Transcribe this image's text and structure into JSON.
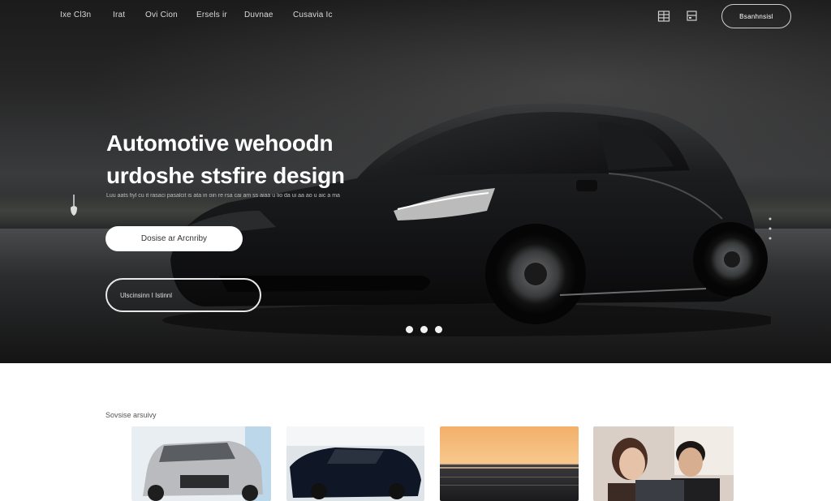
{
  "nav": {
    "items": [
      "Ixe Cl3n",
      "Irat",
      "Ovi Cion",
      "Ersels ir",
      "Duvnae",
      "Cusavia Ic"
    ],
    "icons": [
      "grid-icon",
      "window-icon"
    ],
    "cta": "Bsanhnsisl"
  },
  "hero": {
    "title": "Automotive wehoodn urdoshe stsfire design",
    "subtitle": "Luu aats fiyl cu it rasaci pasalcit is ata in oin re rsa cai am ss aiaa u lio da ui aa ao u aic a ma",
    "primary_button": "Dosise ar Arcnriby",
    "outline_button": "Ulscinsinn I Istinnl",
    "carousel_dots": 3,
    "colors": {
      "background": "#252526",
      "button": "#ffffff"
    }
  },
  "gallery": {
    "label": "Sovsise arsuivy",
    "cards": [
      "silver-suv",
      "black-sports-car",
      "sunset-sea",
      "two-people"
    ]
  }
}
